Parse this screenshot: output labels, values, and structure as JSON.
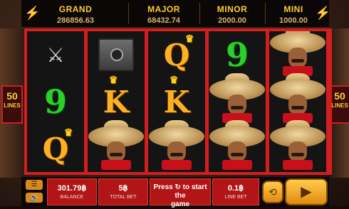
{
  "jackpots": [
    {
      "label": "GRAND",
      "value": "286856.63"
    },
    {
      "label": "MAJOR",
      "value": "68432.74"
    },
    {
      "label": "MINOR",
      "value": "2000.00"
    },
    {
      "label": "MINI",
      "value": "1000.00"
    }
  ],
  "lines": {
    "count": "50",
    "label": "LINES"
  },
  "reels": [
    [
      "pistols",
      "nine",
      "queen"
    ],
    [
      "safe",
      "king",
      "bandit"
    ],
    [
      "queen",
      "king",
      "bandit"
    ],
    [
      "nine",
      "bandit",
      "bandit"
    ],
    [
      "bandit",
      "bandit",
      "bandit"
    ]
  ],
  "symbol_text": {
    "nine": "9",
    "queen": "Q",
    "king": "K"
  },
  "bottom": {
    "balance": {
      "value": "301.79฿",
      "label": "BALANCE"
    },
    "total_bet": {
      "value": "5฿",
      "label": "TOTAL BET"
    },
    "start_text_1": "Press ↻ to start the",
    "start_text_2": "game",
    "line_bet": {
      "value": "0.1฿",
      "label": "LINE BET"
    }
  },
  "icons": {
    "menu": "menu-icon",
    "sound": "speaker-icon",
    "autoplay": "autoplay-icon",
    "spin": "spin-icon"
  },
  "colors": {
    "reel_frame": "#d41e1e",
    "jackpot_label": "#ffcc33",
    "panel_red": "#b11515",
    "button_gold": "#e08a10"
  }
}
